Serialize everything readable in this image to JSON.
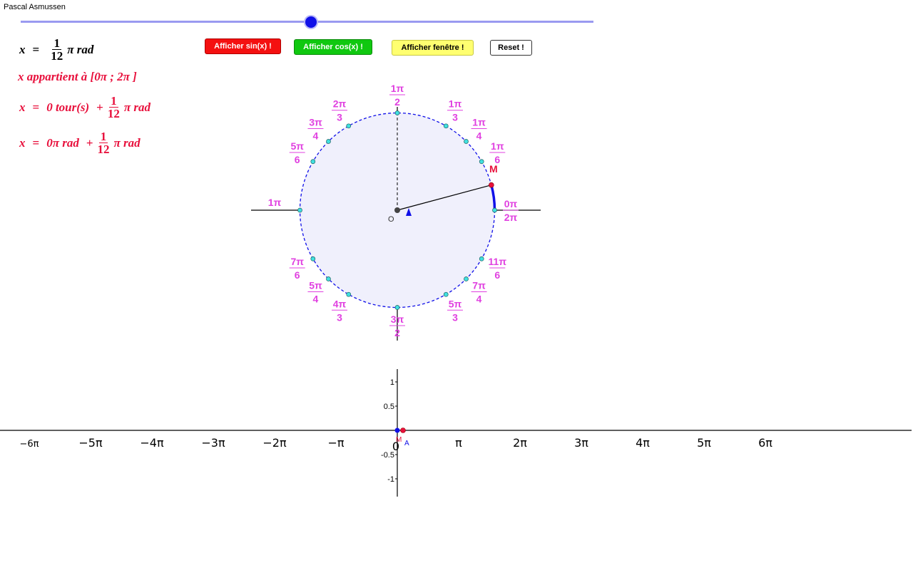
{
  "author": "Pascal Asmussen",
  "slider": {
    "value_fraction": 0.5
  },
  "buttons": {
    "sin": "Afficher sin(x) !",
    "cos": "Afficher cos(x) !",
    "window": "Afficher fenêtre !",
    "reset": "Reset !"
  },
  "formulas": {
    "line1": {
      "lhs": "x",
      "eq": "=",
      "num": "1",
      "den": "12",
      "rest": "π rad"
    },
    "line2": {
      "text": "x appartient à [0π ; 2π ]"
    },
    "line3": {
      "lhs": "x",
      "eq": "=",
      "part1": "0 tour(s)",
      "plus": "+",
      "num": "1",
      "den": "12",
      "rest": "π rad"
    },
    "line4": {
      "lhs": "x",
      "eq": "=",
      "part1": "0π rad",
      "plus": "+",
      "num": "1",
      "den": "12",
      "rest": "π rad"
    }
  },
  "circle": {
    "origin_label": "O",
    "point_label": "M",
    "angle_labels": [
      {
        "num": "0π",
        "den": "2π"
      },
      {
        "num": "1π",
        "den": "6"
      },
      {
        "num": "1π",
        "den": "4"
      },
      {
        "num": "1π",
        "den": "3"
      },
      {
        "num": "1π",
        "den": "2"
      },
      {
        "num": "2π",
        "den": "3"
      },
      {
        "num": "3π",
        "den": "4"
      },
      {
        "num": "5π",
        "den": "6"
      },
      {
        "num": "1π",
        "den": ""
      },
      {
        "num": "7π",
        "den": "6"
      },
      {
        "num": "5π",
        "den": "4"
      },
      {
        "num": "4π",
        "den": "3"
      },
      {
        "num": "3π",
        "den": "2"
      },
      {
        "num": "5π",
        "den": "3"
      },
      {
        "num": "7π",
        "den": "4"
      },
      {
        "num": "11π",
        "den": "6"
      }
    ]
  },
  "graph": {
    "x_ticks": [
      "−6π",
      "−5π",
      "−4π",
      "−3π",
      "−2π",
      "−π",
      "0",
      "π",
      "2π",
      "3π",
      "4π",
      "5π",
      "6π"
    ],
    "y_ticks": [
      "1",
      "0.5",
      "-0.5",
      "-1"
    ],
    "point_label_m": "M",
    "point_label_a": "A"
  },
  "colors": {
    "magenta": "#e040e0",
    "red": "#e8103c",
    "blue": "#1010e8",
    "disk_fill": "#f0f0fc",
    "slider": "#9a9af0"
  },
  "angle_value": {
    "fraction_of_pi": 0.0833
  }
}
